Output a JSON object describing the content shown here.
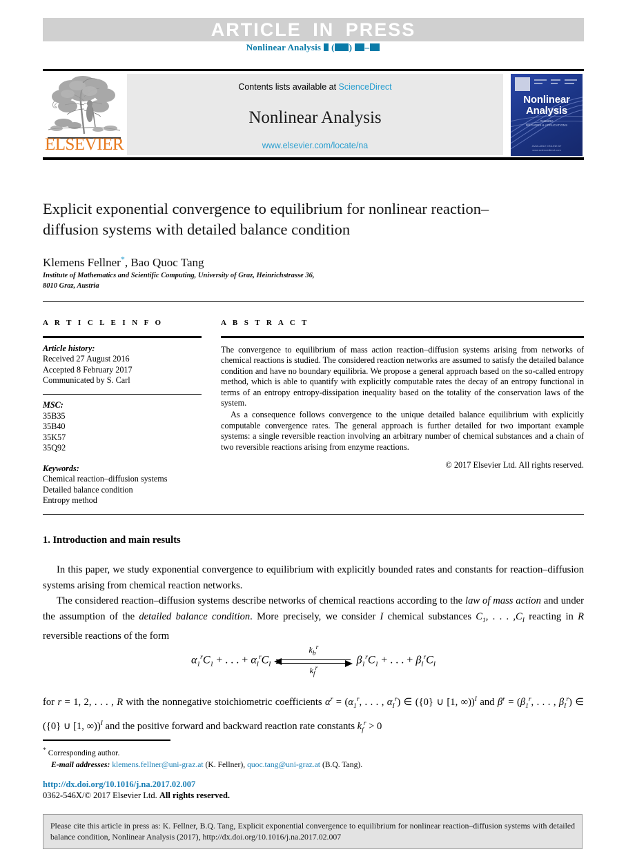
{
  "header": {
    "article_in_press": "ARTICLE IN PRESS",
    "journal_ref_prefix": "Nonlinear Analysis",
    "accent_color": "#0a7ba8"
  },
  "masthead": {
    "contents_text": "Contents lists available at",
    "sciencedirect": "ScienceDirect",
    "journal_name": "Nonlinear Analysis",
    "journal_url": "www.elsevier.com/locate/na",
    "publisher_wordmark": "ELSEVIER",
    "publisher_color": "#e87b20",
    "cover": {
      "title_line1": "Nonlinear",
      "title_line2": "Analysis",
      "subtitle": "THEORY\nMETHODS & APPLICATIONS",
      "bottom_text": "AVAILABLE ONLINE AT\nwww.sciencedirect.com",
      "background_color": "#1c3a8f"
    }
  },
  "article": {
    "title": "Explicit exponential convergence to equilibrium for nonlinear reaction–diffusion systems with detailed balance condition",
    "authors": "Klemens Fellner, Bao Quoc Tang",
    "corresponding_marker": "*",
    "affiliation_line1": "Institute of Mathematics and Scientific Computing, University of Graz, Heinrichstrasse 36,",
    "affiliation_line2": "8010 Graz, Austria"
  },
  "article_info": {
    "heading": "A R T I C L E    I N F O",
    "history_label": "Article history:",
    "received": "Received 27 August 2016",
    "accepted": "Accepted 8 February 2017",
    "communicated": "Communicated by S. Carl",
    "msc_label": "MSC:",
    "msc_codes": [
      "35B35",
      "35B40",
      "35K57",
      "35Q92"
    ],
    "keywords_label": "Keywords:",
    "keywords": [
      "Chemical reaction–diffusion systems",
      "Detailed balance condition",
      "Entropy method"
    ]
  },
  "abstract": {
    "heading": "A B S T R A C T",
    "paragraph1": "The convergence to equilibrium of mass action reaction–diffusion systems arising from networks of chemical reactions is studied. The considered reaction networks are assumed to satisfy the detailed balance condition and have no boundary equilibria. We propose a general approach based on the so-called entropy method, which is able to quantify with explicitly computable rates the decay of an entropy functional in terms of an entropy entropy-dissipation inequality based on the totality of the conservation laws of the system.",
    "paragraph2": "As a consequence follows convergence to the unique detailed balance equilibrium with explicitly computable convergence rates. The general approach is further detailed for two important example systems: a single reversible reaction involving an arbitrary number of chemical substances and a chain of two reversible reactions arising from enzyme reactions.",
    "copyright": "© 2017 Elsevier Ltd. All rights reserved."
  },
  "body": {
    "section_heading": "1. Introduction and main results",
    "para1": "In this paper, we study exponential convergence to equilibrium with explicitly bounded rates and constants for reaction–diffusion systems arising from chemical reaction networks.",
    "para2_a": "The considered reaction–diffusion systems describe networks of chemical reactions according to the ",
    "para2_em1": "law of mass action",
    "para2_b": " and under the assumption of the ",
    "para2_em2": "detailed balance condition",
    "para2_c": ". More precisely, we consider ",
    "para2_var1": "I",
    "para2_d": " chemical substances ",
    "para2_subst": "C₁, . . . , C_I",
    "para2_e": " reacting in ",
    "para2_var2": "R",
    "para2_f": " reversible reactions of the form",
    "equation": {
      "lhs": "α₁ʳ C₁ + . . . + α_Iʳ C_I",
      "rate_above": "k_b^r",
      "rate_below": "k_f^r",
      "rhs": "β₁ʳ C₁ + . . . + β_Iʳ C_I"
    },
    "after_equation": "for r = 1, 2, . . . , R with the nonnegative stoichiometric coefficients αʳ = (α₁ʳ, . . . , α_Iʳ) ∈ ({0} ∪ [1, ∞))^I and βʳ = (β₁ʳ, . . . , β_Iʳ) ∈ ({0} ∪ [1, ∞))^I and the positive forward and backward reaction rate constants k_f^r > 0"
  },
  "footnotes": {
    "corresponding_author": "Corresponding author.",
    "email_label": "E-mail addresses:",
    "email1": "klemens.fellner@uni-graz.at",
    "email1_owner": "(K. Fellner),",
    "email2": "quoc.tang@uni-graz.at",
    "email2_owner": "(B.Q. Tang).",
    "doi": "http://dx.doi.org/10.1016/j.na.2017.02.007",
    "issn_prefix": "0362-546X/© 2017 Elsevier Ltd.",
    "issn_suffix": "All rights reserved."
  },
  "citation_box": {
    "text": "Please cite this article in press as: K. Fellner, B.Q. Tang, Explicit exponential convergence to equilibrium for nonlinear reaction–diffusion systems with detailed balance condition, Nonlinear Analysis (2017), http://dx.doi.org/10.1016/j.na.2017.02.007"
  }
}
